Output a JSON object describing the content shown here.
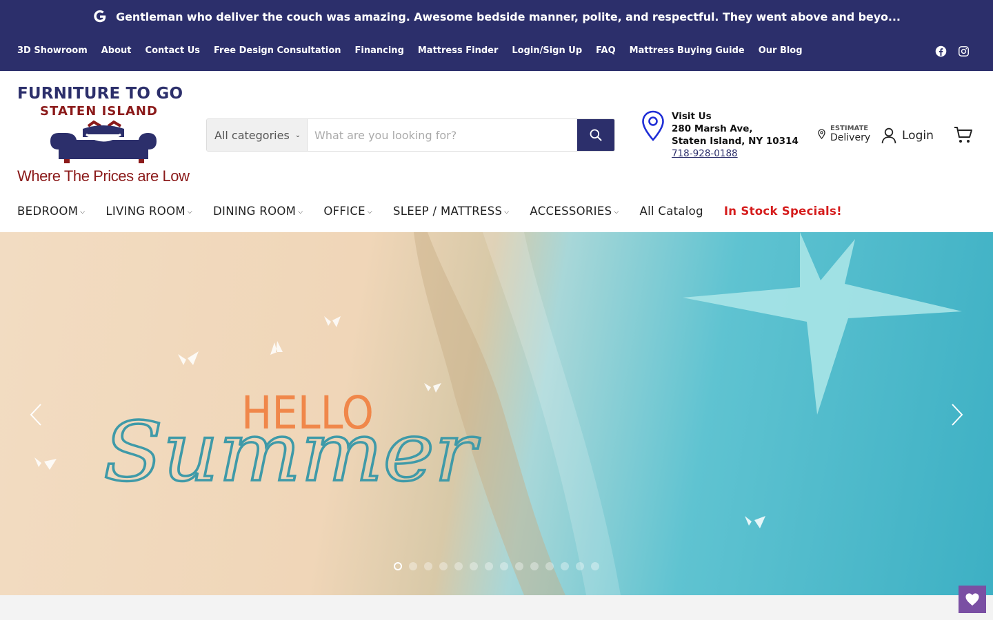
{
  "announcement": {
    "text": "Gentleman who deliver the couch was amazing. Awesome bedside manner, polite, and respectful. They went above and beyo..."
  },
  "utility_nav": [
    "3D Showroom",
    "About",
    "Contact Us",
    "Free Design Consultation",
    "Financing",
    "Mattress Finder",
    "Login/Sign Up",
    "FAQ",
    "Mattress Buying Guide",
    "Our Blog"
  ],
  "logo": {
    "line1": "FURNITURE TO GO",
    "line2": "STATEN ISLAND",
    "tagline": "Where The Prices are Low"
  },
  "search": {
    "category": "All categories",
    "placeholder": "What are you looking for?"
  },
  "visit": {
    "label": "Visit Us",
    "address1": "280 Marsh Ave,",
    "address2": "Staten Island, NY 10314",
    "phone": "718-928-0188"
  },
  "estimate": {
    "small": "ESTIMATE",
    "big": "Delivery"
  },
  "account": {
    "login_label": "Login"
  },
  "main_nav": {
    "bedroom": "BEDROOM",
    "living_room": "LIVING ROOM",
    "dining_room": "DINING ROOM",
    "office": "OFFICE",
    "sleep": "SLEEP / MATTRESS",
    "accessories": "ACCESSORIES",
    "catalog": "All Catalog",
    "specials": "In Stock Specials!"
  },
  "hero": {
    "hello": "HELLO",
    "summer": "Summer",
    "slide_count": 14,
    "active_slide": 1
  },
  "colors": {
    "brand_navy": "#2c2f6b",
    "logo_red": "#8b1a1a",
    "special_red": "#d51c1c",
    "hello_orange": "#f0874a",
    "summer_teal": "#3f9aa8",
    "wishlist_purple": "#7a4fa3"
  },
  "icons": [
    "google-icon",
    "facebook-icon",
    "instagram-icon",
    "search-icon",
    "location-pin-icon",
    "small-pin-icon",
    "user-icon",
    "cart-icon",
    "chevron-down-icon",
    "arrow-left-icon",
    "arrow-right-icon",
    "heart-icon"
  ]
}
